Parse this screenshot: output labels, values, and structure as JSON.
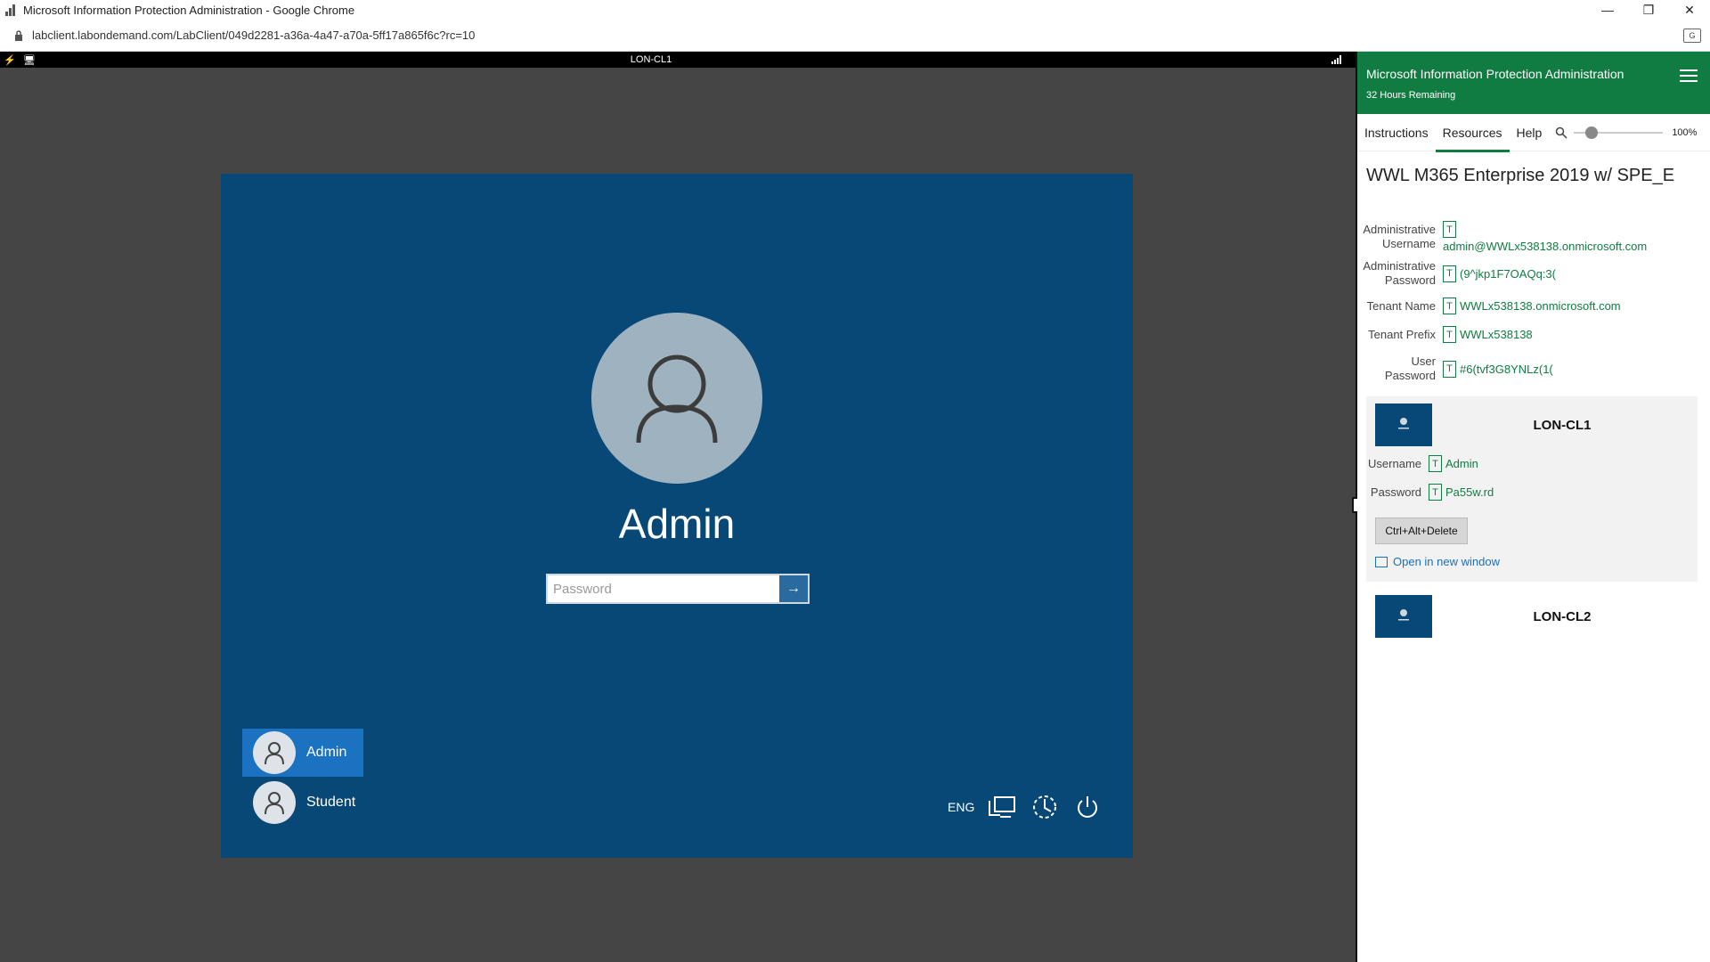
{
  "browser": {
    "window_title": "Microsoft Information Protection Administration - Google Chrome",
    "url": "labclient.labondemand.com/LabClient/049d2281-a36a-4a47-a70a-5ff17a865f6c?rc=10"
  },
  "vm_view": {
    "toolbar_title": "LON-CL1",
    "login": {
      "user_name": "Admin",
      "password_placeholder": "Password",
      "users": [
        "Admin",
        "Student"
      ],
      "active_user": "Admin",
      "language": "ENG"
    }
  },
  "panel": {
    "title": "Microsoft Information Protection Administration",
    "time_remaining": "32 Hours Remaining",
    "tabs": [
      "Instructions",
      "Resources",
      "Help"
    ],
    "active_tab": "Resources",
    "zoom": "100%",
    "zoom_level": 0.2,
    "environment_title": "WWL M365 Enterprise 2019 w/ SPE_E",
    "credentials": [
      {
        "label_line1": "Administrative",
        "label_line2": "Username",
        "value": "admin@WWLx538138.onmicrosoft.com"
      },
      {
        "label_line1": "Administrative",
        "label_line2": "Password",
        "value": "(9^jkp1F7OAQq:3("
      },
      {
        "label_line1": "Tenant Name",
        "label_line2": "",
        "value": "WWLx538138.onmicrosoft.com"
      },
      {
        "label_line1": "Tenant Prefix",
        "label_line2": "",
        "value": "WWLx538138"
      },
      {
        "label_line1": "User Password",
        "label_line2": "",
        "value": "#6(tvf3G8YNLz(1("
      }
    ],
    "t_button": "T",
    "vms": [
      {
        "name": "LON-CL1",
        "username_label": "Username",
        "username": "Admin",
        "password_label": "Password",
        "password": "Pa55w.rd",
        "cad_label": "Ctrl+Alt+Delete",
        "open_new_label": "Open in new window"
      },
      {
        "name": "LON-CL2"
      }
    ]
  }
}
